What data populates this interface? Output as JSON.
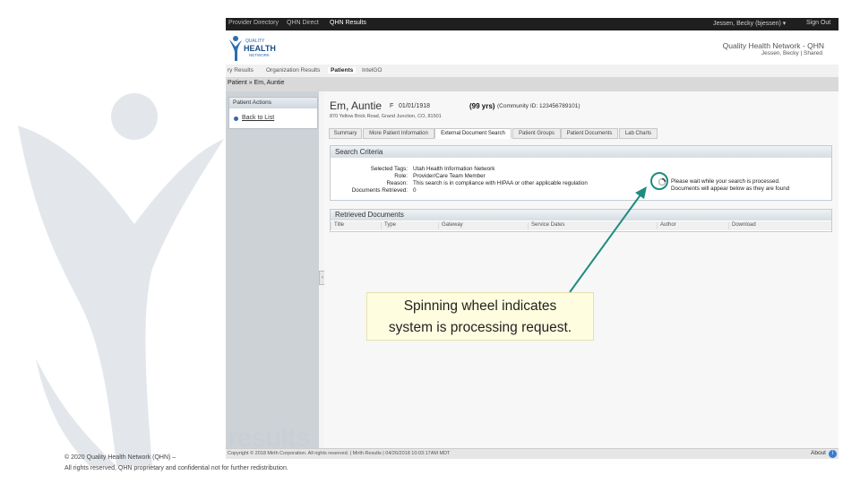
{
  "topbar": {
    "nav": [
      "Provider Directory",
      "QHN Direct",
      "QHN Results"
    ],
    "active": "QHN Results",
    "user": "Jessen, Becky (bjessen) ▾",
    "signout": "Sign Out"
  },
  "header": {
    "logo_line1": "QUALITY",
    "logo_line2": "HEALTH",
    "logo_line3": "NETWORK",
    "org_name": "Quality Health Network - QHN",
    "user_line": "Jessen, Becky | Shared"
  },
  "subnav": {
    "tabs": [
      "ry Results",
      "Organization Results",
      "Patients",
      "IntelGO"
    ],
    "active": "Patients"
  },
  "breadcrumb": "Patient » Em, Auntie",
  "actions": {
    "title": "Patient Actions",
    "back": "Back to List"
  },
  "patient": {
    "name": "Em, Auntie",
    "sex": "F",
    "dob": "01/01/1918",
    "age": "(99 yrs)",
    "community_id": "(Community ID: 123456789101)",
    "address": "870 Yellow Brick Road, Grand Junction, CO, 81501"
  },
  "patient_tabs": [
    "Summary",
    "More Patient Information",
    "External Document Search",
    "Patient Groups",
    "Patient Documents",
    "Lab Charts"
  ],
  "patient_tab_active": "External Document Search",
  "search_criteria": {
    "title": "Search Criteria",
    "labels": [
      "Selected Tags:",
      "Role:",
      "Reason:",
      "Documents Retrieved:"
    ],
    "values": [
      "Utah Health Information Network",
      "Provider/Care Team Member",
      "This search is in compliance with HIPAA or other applicable regulation",
      "0"
    ],
    "wait_line1": "Please wait while your search is processed.",
    "wait_line2": "Documents will appear below as they are found"
  },
  "retrieved": {
    "title": "Retrieved Documents",
    "columns": [
      "Title",
      "Type",
      "Gateway",
      "Service Dates",
      "Author",
      "Download"
    ]
  },
  "watermark": "results",
  "footer": {
    "text": "Copyright © 2018 Mirth Corporation. All rights reserved. | Mirth Results | 04/26/2018 10:03:17AM MDT",
    "about": "About",
    "about_icon": "i"
  },
  "callout": {
    "line1": "Spinning wheel indicates",
    "line2": "system is processing request."
  },
  "copyright": {
    "line1": "© 2020 Quality Health Network (QHN) –",
    "line2": "All rights reserved, QHN proprietary and confidential not for further redistribution."
  },
  "colors": {
    "accent_teal": "#1e8c80",
    "topbar": "#1f1f1f",
    "callout_bg": "#fffde0"
  },
  "icons": [
    "spinner-icon",
    "bullet-icon",
    "info-icon",
    "qhn-figure-logo"
  ]
}
